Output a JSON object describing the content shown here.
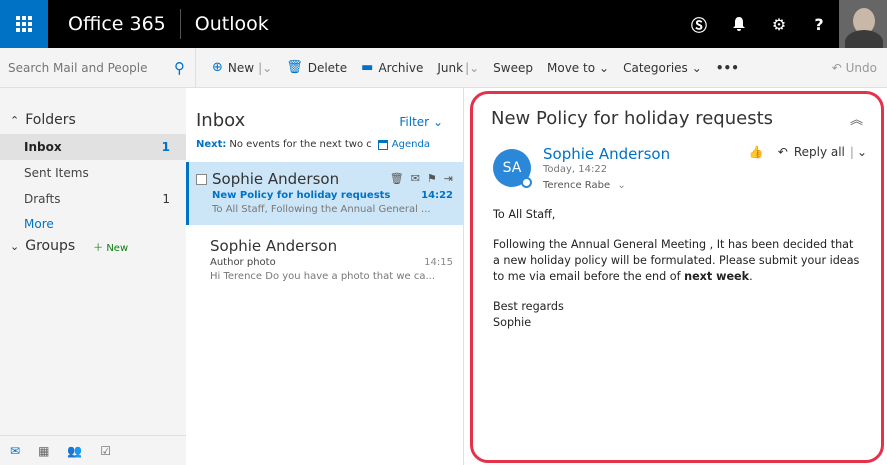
{
  "topbar": {
    "brand": "Office 365",
    "app": "Outlook",
    "icons": [
      "skype-icon",
      "bell-icon",
      "gear-icon",
      "help-icon"
    ],
    "icon_glyphs": [
      "Ⓢ",
      "🔔",
      "⚙",
      "?"
    ]
  },
  "search": {
    "placeholder": "Search Mail and People"
  },
  "commands": {
    "new": "New",
    "delete": "Delete",
    "archive": "Archive",
    "junk": "Junk",
    "sweep": "Sweep",
    "move_to": "Move to",
    "categories": "Categories",
    "more": "•••",
    "undo": "Undo"
  },
  "folders": {
    "header": "Folders",
    "items": [
      {
        "label": "Inbox",
        "count": "1"
      },
      {
        "label": "Sent Items",
        "count": ""
      },
      {
        "label": "Drafts",
        "count": "1"
      }
    ],
    "more": "More",
    "groups": "Groups",
    "groups_new": "New"
  },
  "list": {
    "title": "Inbox",
    "filter": "Filter",
    "next_label": "Next:",
    "next_text": "No events for the next two c",
    "agenda": "Agenda",
    "messages": [
      {
        "sender": "Sophie Anderson",
        "subject": "New Policy for holiday requests",
        "time": "14:22",
        "preview": "To All Staff,  Following the Annual General ..."
      },
      {
        "sender": "Sophie Anderson",
        "subject": "Author photo",
        "time": "14:15",
        "preview": "Hi Terence  Do you have a photo that we ca..."
      }
    ]
  },
  "reading": {
    "title": "New Policy for holiday requests",
    "avatar_initials": "SA",
    "sender": "Sophie Anderson",
    "date": "Today, 14:22",
    "recipient": "Terence Rabe",
    "reply_all": "Reply all",
    "greeting": "To All Staff,",
    "body_main": "Following the Annual General Meeting , It has been decided that a new holiday policy will be formulated. Please submit your ideas to me via email before the end of ",
    "body_bold": "next week",
    "body_end": ".",
    "signoff": "Best regards",
    "signature": "Sophie"
  },
  "colors": {
    "brand_blue": "#0072c6",
    "highlight_red": "#e3324a",
    "selected_bg": "#cde6f7"
  }
}
